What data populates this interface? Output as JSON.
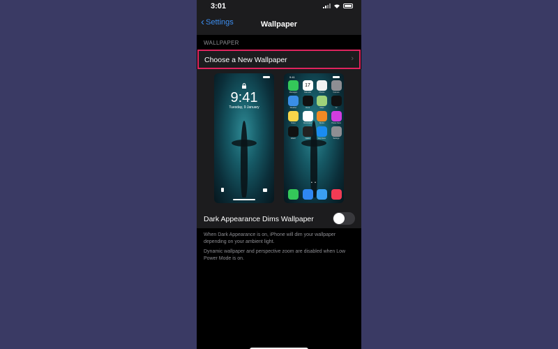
{
  "status_bar": {
    "time": "3:01",
    "icons": [
      "signal-icon",
      "wifi-icon",
      "battery-icon"
    ]
  },
  "nav": {
    "back_label": "Settings",
    "title": "Wallpaper"
  },
  "section": {
    "label": "WALLPAPER"
  },
  "choose_row": {
    "label": "Choose a New Wallpaper",
    "chevron": "›",
    "highlight_color": "#e0245e"
  },
  "lock_preview": {
    "time": "9:41",
    "date": "Tuesday, 9 January"
  },
  "home_preview": {
    "time": "9:41",
    "apps": [
      {
        "name": "Messages",
        "color": "#34c759"
      },
      {
        "name": "Calendar",
        "color": "#ffffff",
        "text": "17"
      },
      {
        "name": "Photos",
        "color": "#f2f2f2"
      },
      {
        "name": "Camera",
        "color": "#8e8e93"
      },
      {
        "name": "Weather",
        "color": "#3a8ee6"
      },
      {
        "name": "Clock",
        "color": "#111111"
      },
      {
        "name": "Maps",
        "color": "#9ed27a"
      },
      {
        "name": "TV",
        "color": "#111111"
      },
      {
        "name": "Notes",
        "color": "#f7d54a"
      },
      {
        "name": "Reminders",
        "color": "#ffffff"
      },
      {
        "name": "Books",
        "color": "#f08a24"
      },
      {
        "name": "iTunes Store",
        "color": "#d23de0"
      },
      {
        "name": "Watch",
        "color": "#111111"
      },
      {
        "name": "Wallet",
        "color": "#222222"
      },
      {
        "name": "App Store",
        "color": "#1a8cf0"
      },
      {
        "name": "Settings",
        "color": "#8e8e93"
      }
    ],
    "dock": [
      {
        "name": "Phone",
        "color": "#34c759"
      },
      {
        "name": "Mail",
        "color": "#2f87f2"
      },
      {
        "name": "Safari",
        "color": "#3a9ff2"
      },
      {
        "name": "Music",
        "color": "#f23b54"
      }
    ]
  },
  "toggle_row": {
    "label": "Dark Appearance Dims Wallpaper",
    "state": "off"
  },
  "footnotes": [
    "When Dark Appearance is on, iPhone will dim your wallpaper depending on your ambient light.",
    "Dynamic wallpaper and perspective zoom are disabled when Low Power Mode is on."
  ]
}
